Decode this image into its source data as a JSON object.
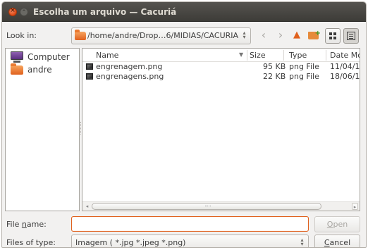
{
  "window": {
    "title": "Escolha um arquivo — Cacuriá"
  },
  "lookin": {
    "label": "Look in:",
    "path": "/home/andre/Drop…6/MIDIAS/CACURIA"
  },
  "sidebar": {
    "items": [
      {
        "label": "Computer",
        "icon": "computer-icon"
      },
      {
        "label": "andre",
        "icon": "home-folder-icon"
      }
    ]
  },
  "files": {
    "columns": [
      "Name",
      "Size",
      "Type",
      "Date Mc"
    ],
    "rows": [
      {
        "name": "engrenagem.png",
        "size": "95 KB",
        "type": "png File",
        "date": "11/04/1"
      },
      {
        "name": "engrenagens.png",
        "size": "22 KB",
        "type": "png File",
        "date": "18/06/1"
      }
    ]
  },
  "form": {
    "filename_label_pre": "File ",
    "filename_label_u": "n",
    "filename_label_post": "ame:",
    "filename_value": "",
    "filetype_label": "Files of type:",
    "filetype_value": "Imagem ( *.jpg *.jpeg *.png)",
    "open_label": "Open",
    "open_u": "O",
    "open_rest": "pen",
    "cancel_u": "C",
    "cancel_rest": "ancel"
  },
  "colors": {
    "accent": "#e0611e",
    "titlebar": "#3d3c38"
  }
}
